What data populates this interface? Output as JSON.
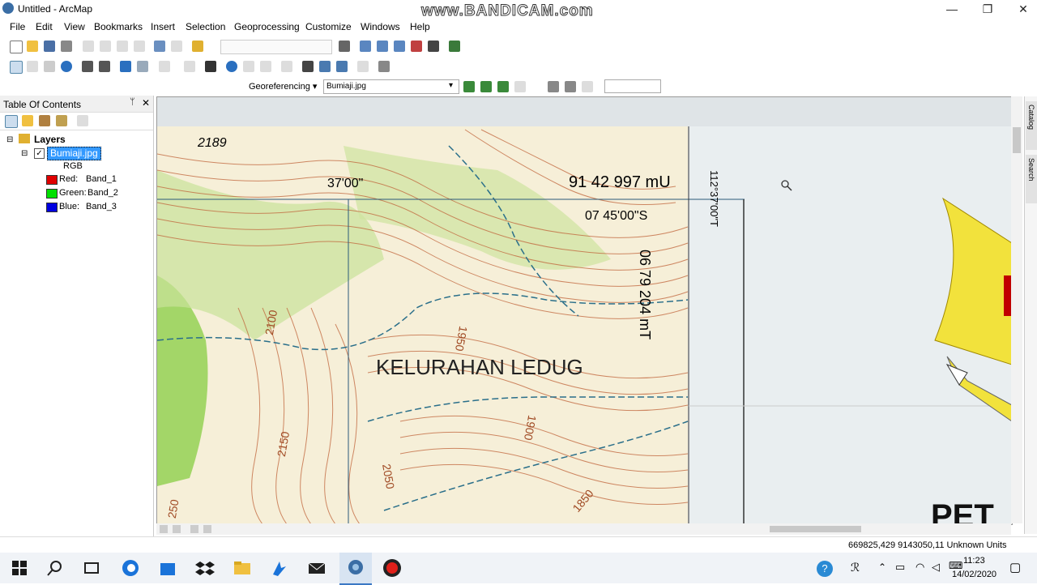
{
  "app": {
    "title": "Untitled - ArcMap",
    "watermark": "www.BANDICAM.com"
  },
  "window_buttons": {
    "minimize": "—",
    "restore": "❐",
    "close": "✕"
  },
  "menu": [
    "File",
    "Edit",
    "View",
    "Bookmarks",
    "Insert",
    "Selection",
    "Geoprocessing",
    "Customize",
    "Windows",
    "Help"
  ],
  "georeferencing": {
    "label": "Georeferencing ▾",
    "layer": "Bumiaji.jpg"
  },
  "toc": {
    "title": "Table Of Contents",
    "root": "Layers",
    "layer": "Bumiaji.jpg",
    "renderer": "RGB",
    "bands": [
      {
        "label": "Red:",
        "band": "Band_1",
        "color": "#e00000"
      },
      {
        "label": "Green:",
        "band": "Band_2",
        "color": "#00e000"
      },
      {
        "label": "Blue:",
        "band": "Band_3",
        "color": "#0000e0"
      }
    ]
  },
  "map": {
    "labels": {
      "elev_2189": "2189",
      "lon_3700": "37'00\"",
      "northing": "91 42 997 mU",
      "lat": "07 45'00\"S",
      "easting": "06 79 204 mT",
      "side_lon": "112°37'00\"T",
      "kelurahan": "KELURAHAN LEDUG",
      "c1950": "1950",
      "c2100": "2100",
      "c1900": "1900",
      "c2150": "2150",
      "c2050": "2050",
      "c1850": "1850",
      "c2250": "250",
      "pet": "PET"
    }
  },
  "right_panel": [
    "Catalog",
    "Search"
  ],
  "status": {
    "coords": "669825,429  9143050,11 Unknown Units"
  },
  "taskbar": {
    "time": "11:23",
    "date": "14/02/2020"
  }
}
